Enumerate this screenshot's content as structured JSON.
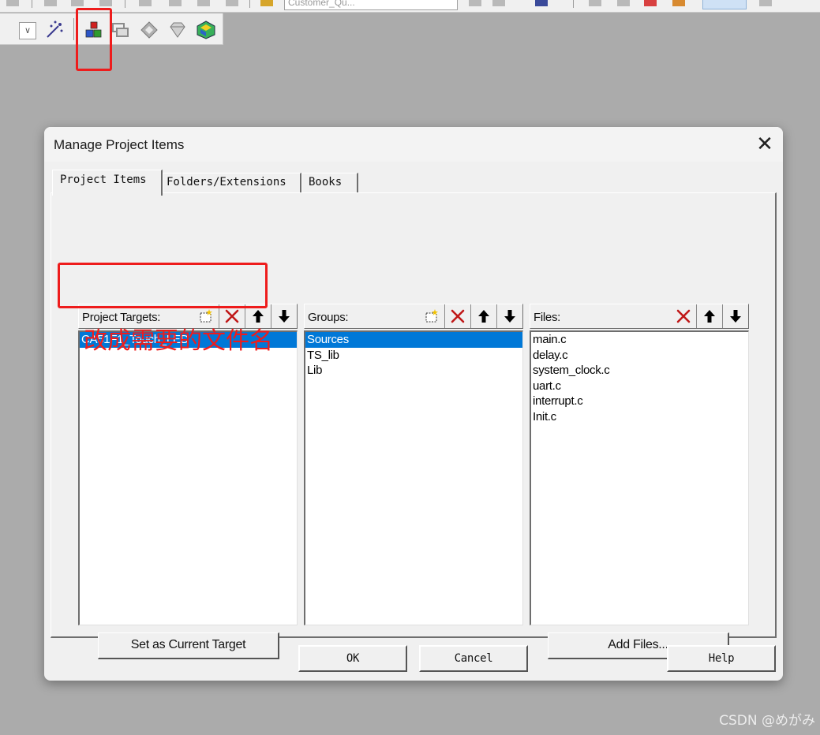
{
  "top_toolbar": {
    "target_combo_value": "Customer_Qu...",
    "dropdown_glyph": "∨"
  },
  "dialog": {
    "title": "Manage Project Items",
    "close_glyph": "✕",
    "tabs": [
      {
        "label": "Project Items",
        "active": true
      },
      {
        "label": "Folders/Extensions",
        "active": false
      },
      {
        "label": "Books",
        "active": false
      }
    ],
    "project_targets": {
      "label": "Project Targets:",
      "items": [
        "CA51F1_Touch_LED"
      ],
      "selected_index": 0
    },
    "groups": {
      "label": "Groups:",
      "items": [
        "Sources",
        "TS_lib",
        "Lib"
      ],
      "selected_index": 0
    },
    "files": {
      "label": "Files:",
      "items": [
        "main.c",
        "delay.c",
        "system_clock.c",
        "uart.c",
        "interrupt.c",
        "Init.c"
      ]
    },
    "buttons": {
      "set_current_target": "Set as Current Target",
      "add_files": "Add Files...",
      "ok": "OK",
      "cancel": "Cancel",
      "help": "Help"
    }
  },
  "annotation": {
    "text": "改成需要的文件名",
    "color": "#ee1c1c"
  },
  "watermark": "CSDN @めがみ",
  "colors": {
    "selection": "#0078d7",
    "annotation_red": "#ee1c1c",
    "desktop": "#ababab"
  }
}
